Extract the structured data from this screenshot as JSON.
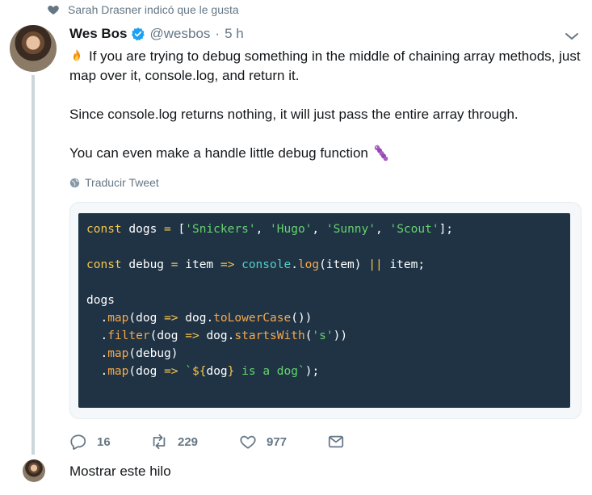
{
  "social_context": {
    "text": "Sarah Drasner indicó que le gusta",
    "icon": "heart-icon"
  },
  "tweet": {
    "author_name": "Wes Bos",
    "verified": true,
    "handle": "@wesbos",
    "separator": "·",
    "time": "5 h",
    "paragraphs": [
      "If you are trying to debug something in the middle of chaining array methods, just map over it, console.log, and return it.",
      "Since console.log returns nothing, it will just pass the entire array through.",
      "You can even make a handle little debug function"
    ],
    "translate_label": "Traducir Tweet"
  },
  "code": {
    "tokens": [
      {
        "t": "const",
        "c": "kw"
      },
      {
        "t": " dogs ",
        "c": ""
      },
      {
        "t": "=",
        "c": "kw"
      },
      {
        "t": " [",
        "c": ""
      },
      {
        "t": "'Snickers'",
        "c": "str"
      },
      {
        "t": ", ",
        "c": ""
      },
      {
        "t": "'Hugo'",
        "c": "str"
      },
      {
        "t": ", ",
        "c": ""
      },
      {
        "t": "'Sunny'",
        "c": "str"
      },
      {
        "t": ", ",
        "c": ""
      },
      {
        "t": "'Scout'",
        "c": "str"
      },
      {
        "t": "];",
        "c": ""
      },
      {
        "t": "\n\n",
        "c": ""
      },
      {
        "t": "const",
        "c": "kw"
      },
      {
        "t": " debug ",
        "c": ""
      },
      {
        "t": "=",
        "c": "kw"
      },
      {
        "t": " item ",
        "c": ""
      },
      {
        "t": "=>",
        "c": "kw"
      },
      {
        "t": " ",
        "c": ""
      },
      {
        "t": "console",
        "c": "mth"
      },
      {
        "t": ".",
        "c": ""
      },
      {
        "t": "log",
        "c": "fn"
      },
      {
        "t": "(item) ",
        "c": ""
      },
      {
        "t": "||",
        "c": "kw"
      },
      {
        "t": " item;",
        "c": ""
      },
      {
        "t": "\n\n",
        "c": ""
      },
      {
        "t": "dogs",
        "c": ""
      },
      {
        "t": "\n",
        "c": ""
      },
      {
        "t": "  .",
        "c": ""
      },
      {
        "t": "map",
        "c": "fn"
      },
      {
        "t": "(dog ",
        "c": ""
      },
      {
        "t": "=>",
        "c": "kw"
      },
      {
        "t": " dog.",
        "c": ""
      },
      {
        "t": "toLowerCase",
        "c": "fn"
      },
      {
        "t": "())",
        "c": ""
      },
      {
        "t": "\n",
        "c": ""
      },
      {
        "t": "  .",
        "c": ""
      },
      {
        "t": "filter",
        "c": "fn"
      },
      {
        "t": "(dog ",
        "c": ""
      },
      {
        "t": "=>",
        "c": "kw"
      },
      {
        "t": " dog.",
        "c": ""
      },
      {
        "t": "startsWith",
        "c": "fn"
      },
      {
        "t": "(",
        "c": ""
      },
      {
        "t": "'s'",
        "c": "str"
      },
      {
        "t": "))",
        "c": ""
      },
      {
        "t": "\n",
        "c": ""
      },
      {
        "t": "  .",
        "c": ""
      },
      {
        "t": "map",
        "c": "fn"
      },
      {
        "t": "(debug)",
        "c": ""
      },
      {
        "t": "\n",
        "c": ""
      },
      {
        "t": "  .",
        "c": ""
      },
      {
        "t": "map",
        "c": "fn"
      },
      {
        "t": "(dog ",
        "c": ""
      },
      {
        "t": "=>",
        "c": "kw"
      },
      {
        "t": " ",
        "c": ""
      },
      {
        "t": "`",
        "c": "str"
      },
      {
        "t": "${",
        "c": "kw"
      },
      {
        "t": "dog",
        "c": ""
      },
      {
        "t": "}",
        "c": "kw"
      },
      {
        "t": " is a dog`",
        "c": "str"
      },
      {
        "t": ");",
        "c": ""
      }
    ]
  },
  "actions": {
    "replies": "16",
    "retweets": "229",
    "likes": "977"
  },
  "show_thread_label": "Mostrar este hilo",
  "colors": {
    "code_bg": "#1f3345",
    "verified_blue": "#1da1f2",
    "muted": "#657786"
  }
}
